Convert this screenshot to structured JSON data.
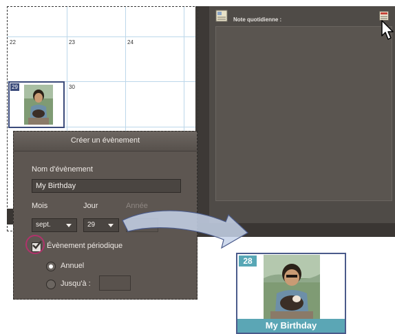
{
  "calendar": {
    "days_row1": [
      "22",
      "23",
      "24"
    ],
    "days_row2": [
      "29",
      "30"
    ]
  },
  "note_panel": {
    "label": "Note quotidienne :"
  },
  "dialog": {
    "title": "Créer un évènement",
    "event_name_label": "Nom d'évènement",
    "event_name_value": "My Birthday",
    "month_label": "Mois",
    "month_value": "sept.",
    "day_label": "Jour",
    "day_value": "29",
    "year_label": "Année",
    "recurring_label": "Évènement périodique",
    "recurring_checked": true,
    "annual_label": "Annuel",
    "annual_selected": true,
    "until_label": "Jusqu'à :"
  },
  "preview_card": {
    "day": "28",
    "caption": "My Birthday"
  },
  "colors": {
    "accent_teal": "#5ba6b5",
    "highlight_ring": "#b0336b",
    "selected_border": "#3a4a7a"
  },
  "icons": [
    "note-icon",
    "note-edit-icon",
    "mouse-cursor-icon",
    "checkmark-icon",
    "flow-arrow-icon"
  ]
}
